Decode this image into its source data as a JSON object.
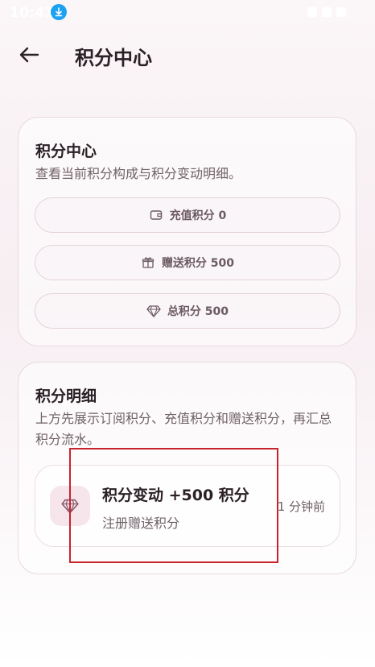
{
  "status_bar": {
    "time": "10:41",
    "download_icon": "download-icon"
  },
  "header": {
    "back_icon": "arrow-left-icon",
    "title": "积分中心"
  },
  "overview_card": {
    "title": "积分中心",
    "description": "查看当前积分构成与积分变动明细。",
    "pills": [
      {
        "icon": "wallet-icon",
        "label": "充值积分 0"
      },
      {
        "icon": "gift-icon",
        "label": "赠送积分 500"
      },
      {
        "icon": "diamond-icon",
        "label": "总积分 500"
      }
    ]
  },
  "detail_card": {
    "title": "积分明细",
    "description": "上方先展示订阅积分、充值积分和赠送积分，再汇总积分流水。",
    "items": [
      {
        "icon": "diamond-icon",
        "title": "积分变动 +500 积分",
        "subtitle": "注册赠送积分",
        "time": "1 分钟前"
      }
    ]
  },
  "colors": {
    "accent": "#8a5a6e",
    "highlight_border": "#c8242b",
    "icon_bg": "#f6e6ec"
  }
}
